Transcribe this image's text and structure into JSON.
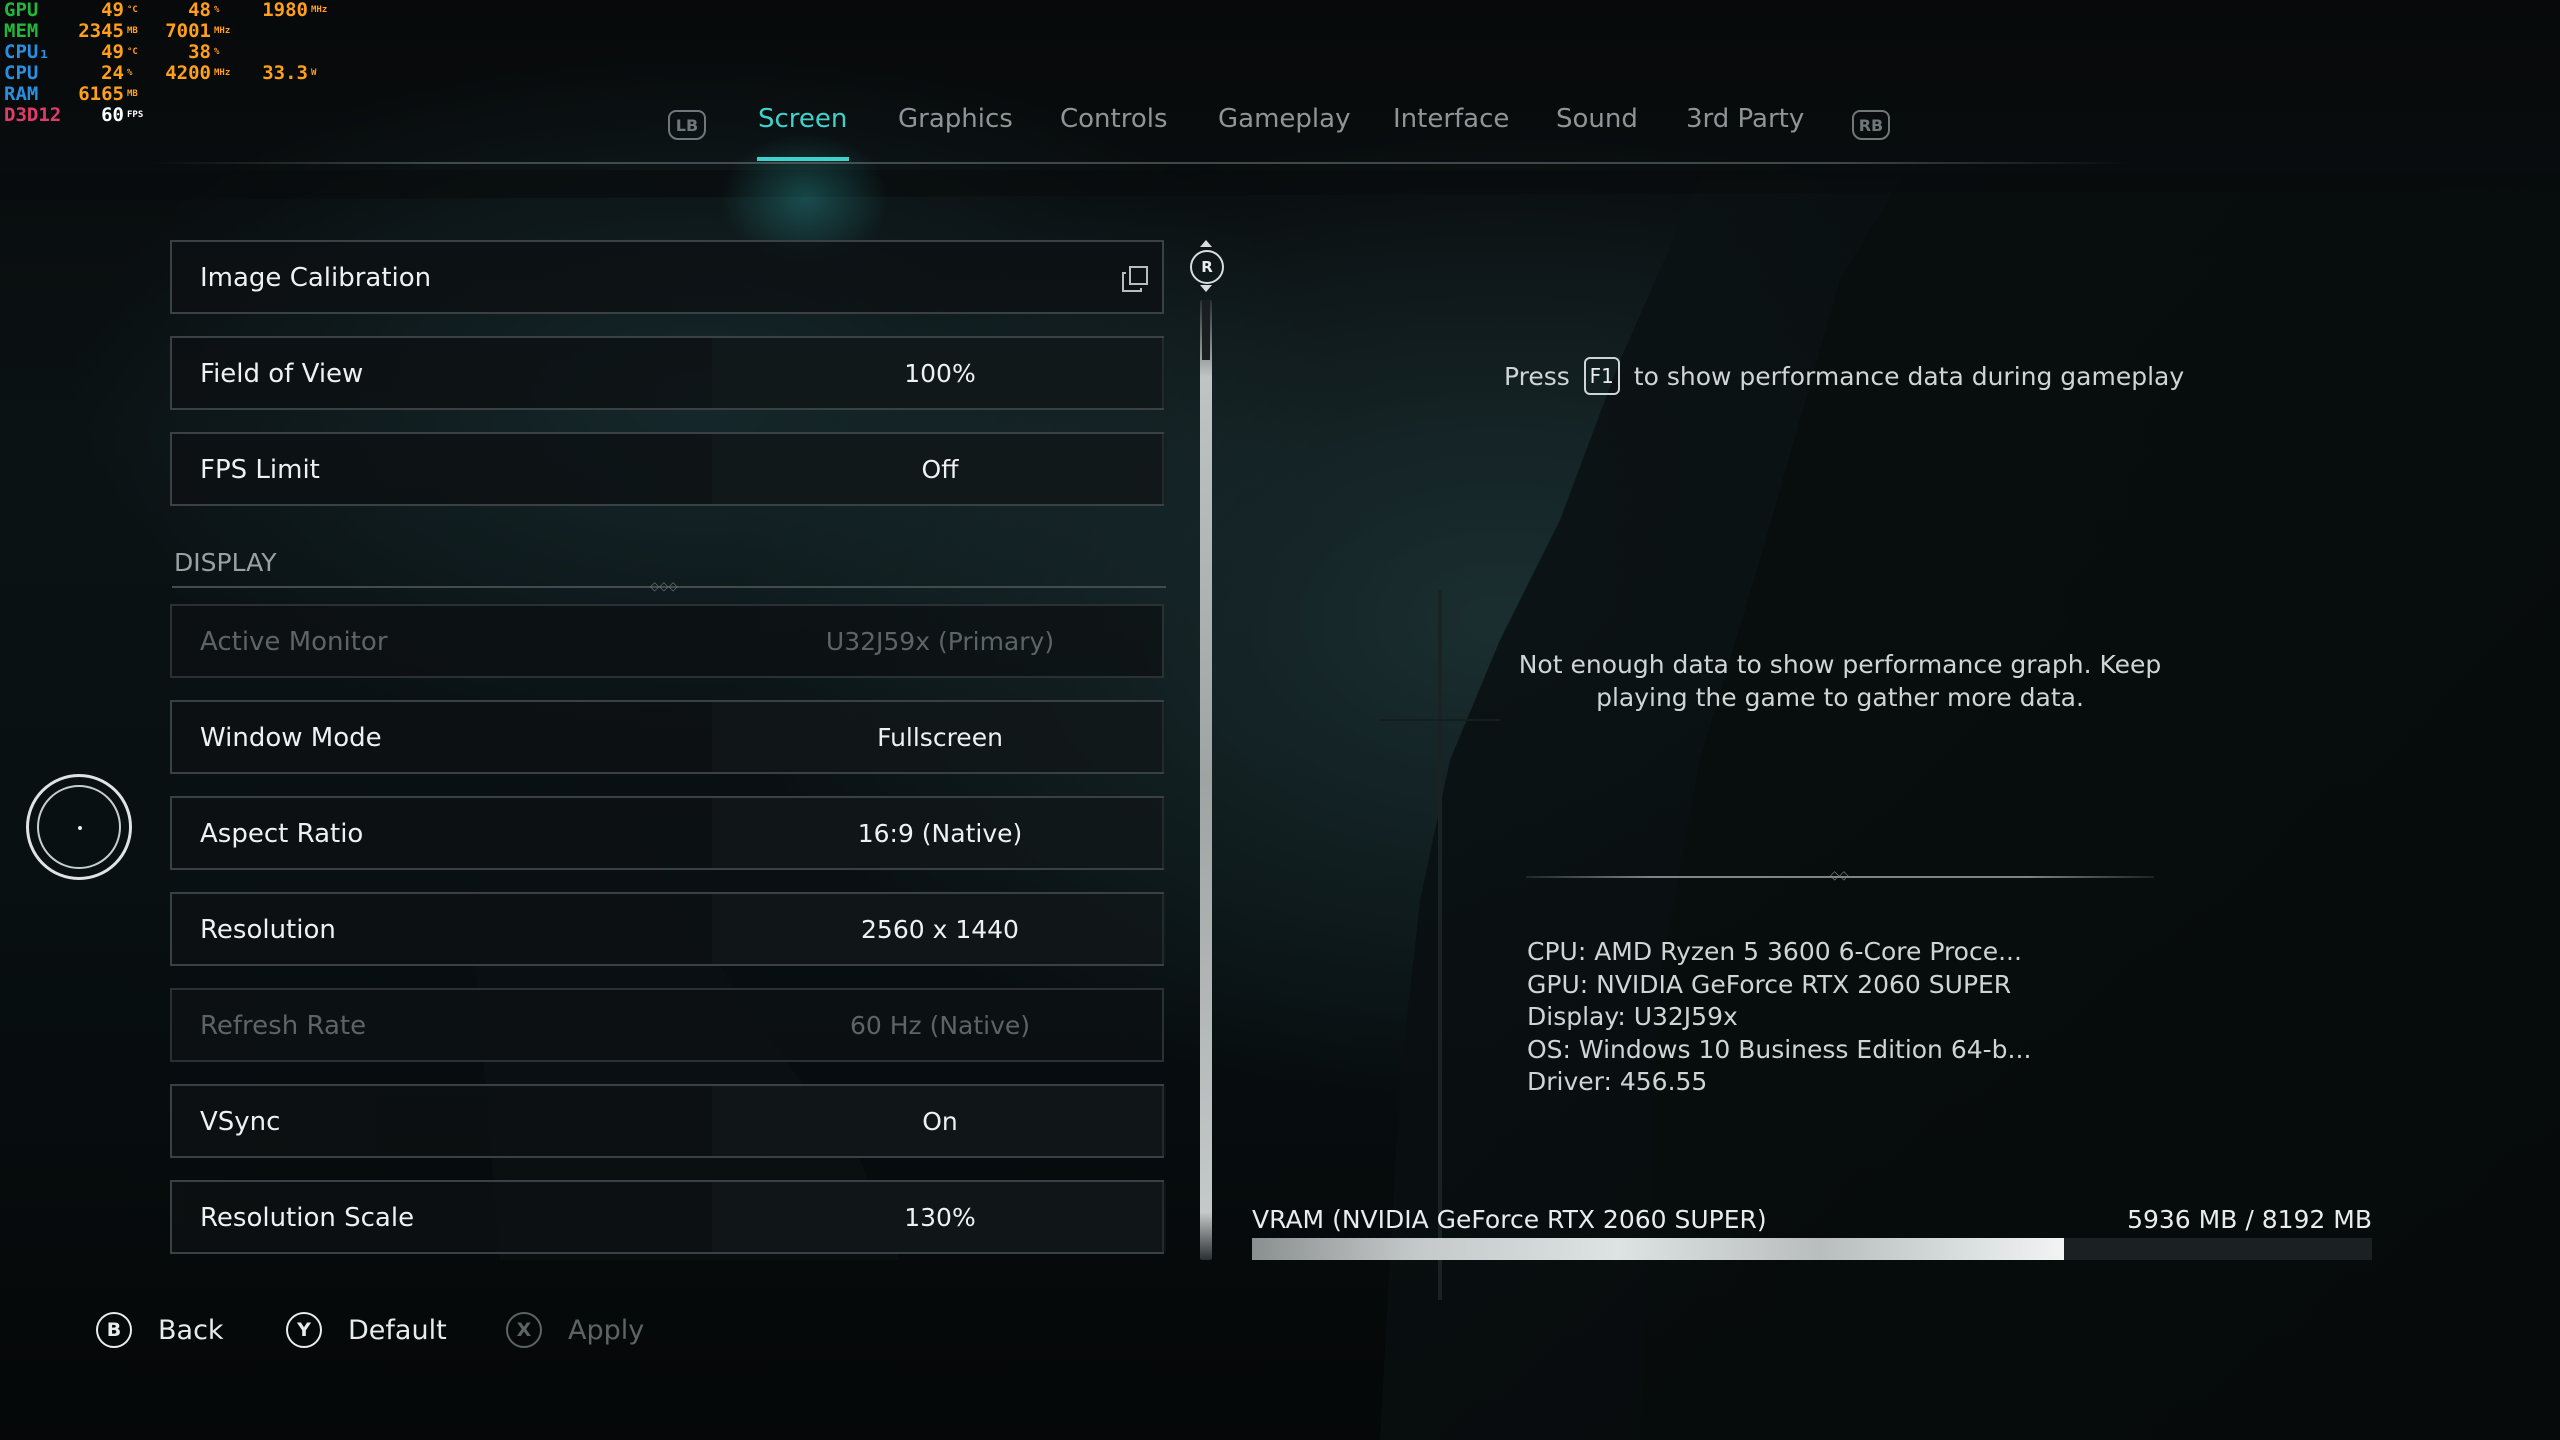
{
  "hud": {
    "rows": [
      {
        "label": "GPU",
        "v1": "49",
        "u1": "°C",
        "v2": "48",
        "u2": "%",
        "v3": "1980",
        "u3": "MHz"
      },
      {
        "label": "MEM",
        "v1": "2345",
        "u1": "MB",
        "v2": "7001",
        "u2": "MHz",
        "v3": "",
        "u3": ""
      },
      {
        "label": "CPU₁",
        "v1": "49",
        "u1": "°C",
        "v2": "38",
        "u2": "%",
        "v3": "",
        "u3": ""
      },
      {
        "label": "CPU",
        "v1": "24",
        "u1": "%",
        "v2": "4200",
        "u2": "MHz",
        "v3": "33.3",
        "u3": "W"
      },
      {
        "label": "RAM",
        "v1": "6165",
        "u1": "MB",
        "v2": "",
        "u2": "",
        "v3": "",
        "u3": ""
      },
      {
        "label": "D3D12",
        "v1": "60",
        "u1": "FPS",
        "v2": "",
        "u2": "",
        "v3": "",
        "u3": ""
      }
    ]
  },
  "tabs": {
    "left_bumper": "LB",
    "right_bumper": "RB",
    "items": [
      {
        "label": "Screen",
        "active": true
      },
      {
        "label": "Graphics",
        "active": false
      },
      {
        "label": "Controls",
        "active": false
      },
      {
        "label": "Gameplay",
        "active": false
      },
      {
        "label": "Interface",
        "active": false
      },
      {
        "label": "Sound",
        "active": false
      },
      {
        "label": "3rd Party",
        "active": false
      }
    ]
  },
  "settings": {
    "image_calibration": {
      "label": "Image Calibration"
    },
    "field_of_view": {
      "label": "Field of View",
      "value": "100%"
    },
    "fps_limit": {
      "label": "FPS Limit",
      "value": "Off"
    },
    "display_section": "DISPLAY",
    "active_monitor": {
      "label": "Active Monitor",
      "value": "U32J59x (Primary)",
      "disabled": true
    },
    "window_mode": {
      "label": "Window Mode",
      "value": "Fullscreen"
    },
    "aspect_ratio": {
      "label": "Aspect Ratio",
      "value": "16:9 (Native)"
    },
    "resolution": {
      "label": "Resolution",
      "value": "2560 x 1440"
    },
    "refresh_rate": {
      "label": "Refresh Rate",
      "value": "60 Hz (Native)",
      "disabled": true
    },
    "vsync": {
      "label": "VSync",
      "value": "On"
    },
    "resolution_scale": {
      "label": "Resolution Scale",
      "value": "130%"
    }
  },
  "scroll_knob": "R",
  "info": {
    "perf_prefix": "Press",
    "perf_key": "F1",
    "perf_suffix": "to show performance data during gameplay",
    "no_data": "Not enough data to show performance graph. Keep playing the game to gather more data.",
    "cpu": "CPU: AMD Ryzen 5 3600 6-Core Proce...",
    "gpu": "GPU: NVIDIA GeForce RTX 2060 SUPER",
    "display": "Display: U32J59x",
    "os": "OS: Windows 10 Business Edition 64-b...",
    "driver": "Driver: 456.55",
    "vram_label": "VRAM (NVIDIA GeForce RTX 2060 SUPER)",
    "vram_value": "5936 MB / 8192 MB",
    "vram_used_fraction": 0.7246
  },
  "actions": {
    "back": {
      "button": "B",
      "label": "Back"
    },
    "default": {
      "button": "Y",
      "label": "Default"
    },
    "apply": {
      "button": "X",
      "label": "Apply",
      "disabled": true
    }
  },
  "colors": {
    "accent": "#3fd2cc",
    "text": "#e8ecee",
    "disabled": "#5d6466",
    "hud_orange": "#ff9f1a"
  }
}
